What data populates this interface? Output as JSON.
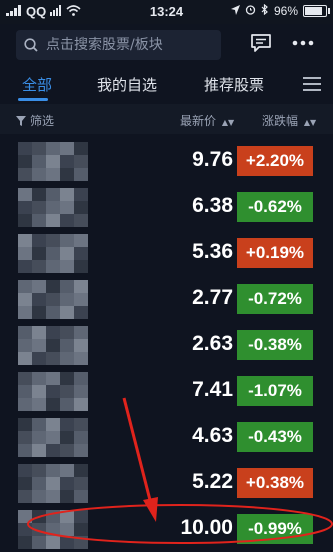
{
  "status_bar": {
    "carrier": "QQ",
    "time": "13:24",
    "battery": "96%",
    "battery_level": 0.96
  },
  "search": {
    "placeholder": "点击搜索股票/板块"
  },
  "tabs": [
    {
      "label": "全部",
      "active": true
    },
    {
      "label": "我的自选",
      "active": false
    },
    {
      "label": "推荐股票",
      "active": false
    }
  ],
  "list_header": {
    "filter_label": "筛选",
    "price_label": "最新价",
    "change_label": "涨跌幅"
  },
  "stocks": [
    {
      "price": "9.76",
      "change": "+2.20%",
      "direction": "up"
    },
    {
      "price": "6.38",
      "change": "-0.62%",
      "direction": "down"
    },
    {
      "price": "5.36",
      "change": "+0.19%",
      "direction": "up"
    },
    {
      "price": "2.77",
      "change": "-0.72%",
      "direction": "down"
    },
    {
      "price": "2.63",
      "change": "-0.38%",
      "direction": "down"
    },
    {
      "price": "7.41",
      "change": "-1.07%",
      "direction": "down"
    },
    {
      "price": "4.63",
      "change": "-0.43%",
      "direction": "down"
    },
    {
      "price": "5.22",
      "change": "+0.38%",
      "direction": "up"
    },
    {
      "price": "10.00",
      "change": "-0.99%",
      "direction": "down"
    }
  ],
  "colors": {
    "background": "#0f1420",
    "accent": "#3a8ee6",
    "up": "#c9401c",
    "down": "#2f8f2f",
    "annotation": "#e0231c"
  }
}
